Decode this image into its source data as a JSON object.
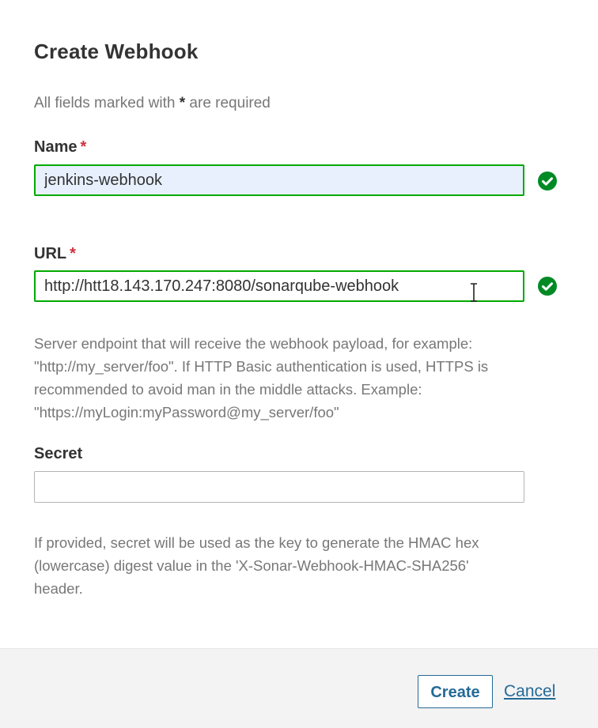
{
  "dialog": {
    "title": "Create Webhook",
    "required_note_prefix": "All fields marked with",
    "required_note_star": "*",
    "required_note_suffix": "are required"
  },
  "fields": {
    "name": {
      "label": "Name",
      "required_marker": "*",
      "value": "jenkins-webhook",
      "valid": true
    },
    "url": {
      "label": "URL",
      "required_marker": "*",
      "value": "http://htt18.143.170.247:8080/sonarqube-webhook",
      "valid": true,
      "help_lines": [
        "Server endpoint that will receive the webhook payload, for example:",
        "\"http://my_server/foo\". If HTTP Basic authentication is used, HTTPS is",
        "recommended to avoid man in the middle attacks. Example:",
        "\"https://myLogin:myPassword@my_server/foo\""
      ]
    },
    "secret": {
      "label": "Secret",
      "value": "",
      "help_lines": [
        "If provided, secret will be used as the key to generate the HMAC hex",
        "(lowercase) digest value in the 'X-Sonar-Webhook-HMAC-SHA256'",
        "header."
      ]
    }
  },
  "footer": {
    "create_label": "Create",
    "cancel_label": "Cancel"
  },
  "colors": {
    "accent": "#236a97",
    "valid_border": "#00aa00",
    "valid_icon": "#008a25",
    "required_star": "#d02f3a",
    "autofill_bg": "#e8f0fe"
  },
  "icons": {
    "valid": "check-circle-icon",
    "cursor": "text-cursor-icon"
  }
}
